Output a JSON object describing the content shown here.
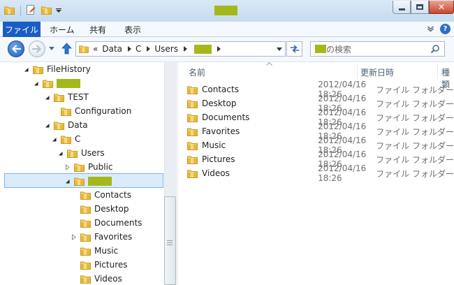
{
  "ribbon": {
    "tabs": [
      {
        "label": "ファイル"
      },
      {
        "label": "ホーム"
      },
      {
        "label": "共有"
      },
      {
        "label": "表示"
      }
    ],
    "help_label": "?"
  },
  "address": {
    "overflow": "«",
    "breadcrumbs": [
      "Data",
      "C",
      "Users"
    ]
  },
  "search": {
    "placeholder_suffix": "の検索"
  },
  "tree": [
    {
      "label": "FileHistory",
      "expanded": true
    },
    {
      "label": "",
      "redacted": true,
      "expanded": true
    },
    {
      "label": "TEST",
      "expanded": true
    },
    {
      "label": "Configuration"
    },
    {
      "label": "Data",
      "expanded": true
    },
    {
      "label": "C",
      "expanded": true
    },
    {
      "label": "Users",
      "expanded": true
    },
    {
      "label": "Public",
      "collapsed": true
    },
    {
      "label": "",
      "redacted": true,
      "expanded": true,
      "selected": true
    },
    {
      "label": "Contacts"
    },
    {
      "label": "Desktop"
    },
    {
      "label": "Documents"
    },
    {
      "label": "Favorites",
      "collapsed": true
    },
    {
      "label": "Music"
    },
    {
      "label": "Pictures"
    },
    {
      "label": "Videos"
    }
  ],
  "list": {
    "columns": {
      "name": "名前",
      "date": "更新日時",
      "type": "種類"
    },
    "rows": [
      {
        "name": "Contacts",
        "date": "2012/04/16 18:26",
        "type": "ファイル フォルダー"
      },
      {
        "name": "Desktop",
        "date": "2012/04/16 18:26",
        "type": "ファイル フォルダー"
      },
      {
        "name": "Documents",
        "date": "2012/04/16 18:26",
        "type": "ファイル フォルダー"
      },
      {
        "name": "Favorites",
        "date": "2012/04/16 18:26",
        "type": "ファイル フォルダー"
      },
      {
        "name": "Music",
        "date": "2012/04/16 18:26",
        "type": "ファイル フォルダー"
      },
      {
        "name": "Pictures",
        "date": "2012/04/16 18:26",
        "type": "ファイル フォルダー"
      },
      {
        "name": "Videos",
        "date": "2012/04/16 18:26",
        "type": "ファイル フォルダー"
      }
    ]
  },
  "colors": {
    "accent": "#1a5ec4",
    "folder": "#e8b83a",
    "selection": "#dcebfc",
    "redaction": "#a5b81a"
  }
}
